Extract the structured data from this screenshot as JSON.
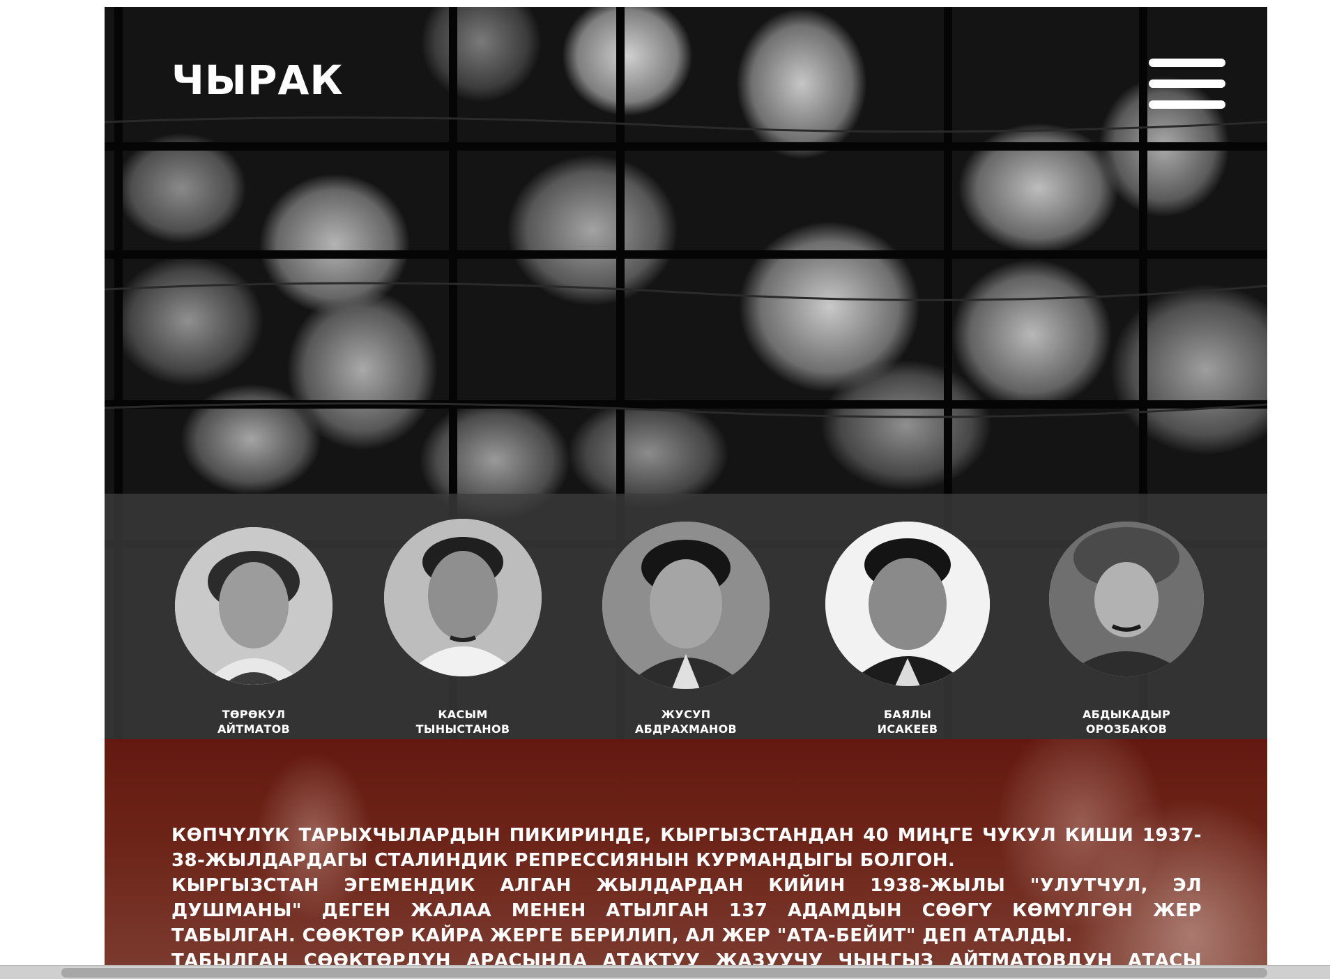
{
  "header": {
    "logo": "ЧЫРАК",
    "menu_icon": "hamburger-menu-icon"
  },
  "people": [
    {
      "first": "ТӨРӨКУЛ",
      "last": "АЙТМАТОВ"
    },
    {
      "first": "КАСЫМ",
      "last": "ТЫНЫСТАНОВ"
    },
    {
      "first": "ЖУСУП",
      "last": "АБДРАХМАНОВ"
    },
    {
      "first": "БАЯЛЫ",
      "last": "ИСАКЕЕВ"
    },
    {
      "first": "АБДЫКАДЫР",
      "last": "ОРОЗБАКОВ"
    }
  ],
  "story": {
    "paragraphs": [
      "КӨПЧҮЛҮК ТАРЫХЧЫЛАРДЫН ПИКИРИНДЕ, КЫРГЫЗСТАНДАН 40 МИҢГЕ ЧУКУЛ КИШИ 1937-38-ЖЫЛДАРДАГЫ СТАЛИНДИК РЕПРЕССИЯНЫН КУРМАНДЫГЫ БОЛГОН.",
      "КЫРГЫЗСТАН ЭГЕМЕНДИК АЛГАН ЖЫЛДАРДАН КИЙИН 1938-ЖЫЛЫ \"УЛУТЧУЛ, ЭЛ ДУШМАНЫ\" ДЕГЕН ЖАЛАА МЕНЕН АТЫЛГАН 137 АДАМДЫН СӨӨГҮ КӨМҮЛГӨН ЖЕР ТАБЫЛГАН. СӨӨКТӨР КАЙРА ЖЕРГЕ БЕРИЛИП, АЛ ЖЕР \"АТА-БЕЙИТ\" ДЕП АТАЛДЫ.",
      "ТАБЫЛГАН СӨӨКТӨРДҮН АРАСЫНДА АТАКТУУ ЖАЗУУЧУ ЧЫҢГЫЗ АЙТМАТОВДУН АТАСЫ ТӨРӨКУЛ"
    ]
  }
}
